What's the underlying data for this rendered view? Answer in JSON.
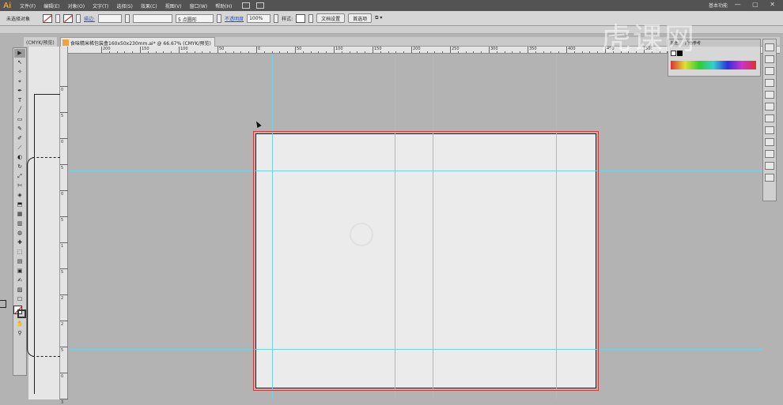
{
  "app": {
    "logo": "Ai",
    "workspace": "基本功能",
    "window_controls": "— ▢ ✕"
  },
  "menu": [
    "文件(F)",
    "编辑(E)",
    "对象(O)",
    "文字(T)",
    "选择(S)",
    "效果(C)",
    "视图(V)",
    "窗口(W)",
    "帮助(H)"
  ],
  "control_bar": {
    "selection_status": "未选择对象",
    "stroke_label": "描边:",
    "brush_value": "5 点圆形",
    "opacity_label": "不透明度",
    "opacity_value": "100%",
    "style_label": "样式:",
    "doc_setup_button": "文档设置",
    "preferences_button": "首选项"
  },
  "tabs": {
    "prev_doc": "(CMYK/预览)",
    "current_doc": "食味精米稀包装盒160x50x230mm.ai* @ 66.67% (CMYK/预览)"
  },
  "ruler": {
    "h_labels": [
      "200",
      "150",
      "100",
      "50",
      "0",
      "50",
      "100",
      "150",
      "200",
      "250",
      "300",
      "350",
      "400",
      "450",
      "500"
    ],
    "v_labels": [
      "0",
      "5",
      "0",
      "5",
      "0",
      "5",
      "1",
      "5",
      "2",
      "2",
      "5",
      "0",
      "3"
    ]
  },
  "color_panel": {
    "tab_color": "颜色",
    "tab_guide": "颜色参考"
  },
  "watermark": "虎课网",
  "tools": [
    "▶",
    "↖",
    "✧",
    "⌖",
    "✒",
    "T",
    "╱",
    "▭",
    "✎",
    "✐",
    "⟋",
    "◐",
    "↻",
    "⤢",
    "✄",
    "◈",
    "⬒",
    "▦",
    "▥",
    "◍",
    "✚",
    "⬚",
    "▤",
    "▣",
    "✍",
    "▨",
    "☐",
    "✋",
    "⚲"
  ]
}
